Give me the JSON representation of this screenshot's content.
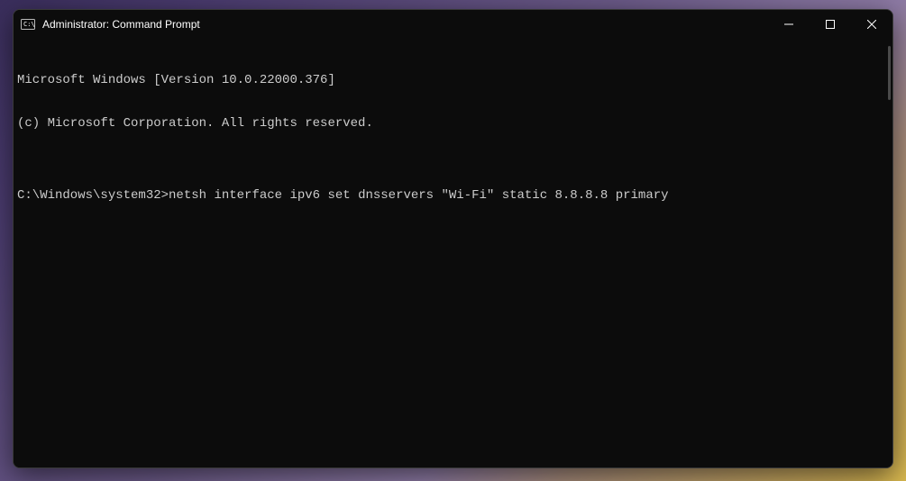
{
  "titlebar": {
    "title": "Administrator: Command Prompt"
  },
  "terminal": {
    "line1": "Microsoft Windows [Version 10.0.22000.376]",
    "line2": "(c) Microsoft Corporation. All rights reserved.",
    "blank": "",
    "prompt": "C:\\Windows\\system32>",
    "command": "netsh interface ipv6 set dnsservers \"Wi-Fi\" static 8.8.8.8 primary"
  }
}
